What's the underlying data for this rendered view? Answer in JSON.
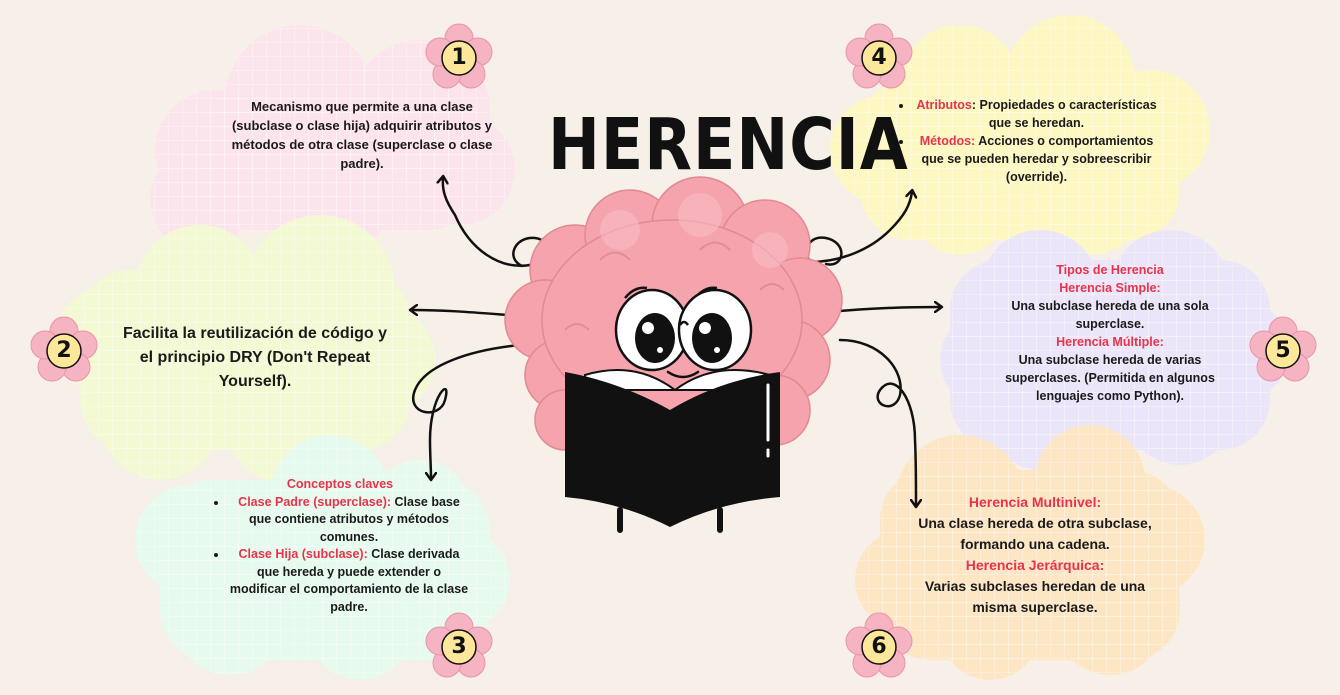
{
  "title": "HERENCIA",
  "colors": {
    "background": "#f7f0e8",
    "accent_red": "#e8334a",
    "cloud1": "#fce4ec",
    "cloud2": "#f3f9d2",
    "cloud3": "#e6fbee",
    "cloud4": "#fdf7c2",
    "cloud5": "#ebe5f9",
    "cloud6": "#fde6c4",
    "badge_petal": "#f6b3c2",
    "badge_center": "#fde79a"
  },
  "clouds": [
    {
      "number": "1",
      "text": "Mecanismo que permite a una clase (subclase o clase hija) adquirir atributos y métodos de otra clase (superclase o clase padre)."
    },
    {
      "number": "2",
      "text": "Facilita la reutilización de código y el principio DRY (Don't Repeat Yourself)."
    },
    {
      "number": "3",
      "heading": "Conceptos claves",
      "items": [
        {
          "label": "Clase Padre (superclase):",
          "text": " Clase base que contiene atributos y métodos comunes."
        },
        {
          "label": "Clase Hija (subclase):",
          "text": " Clase derivada que hereda y puede extender o modificar el comportamiento de la clase padre."
        }
      ]
    },
    {
      "number": "4",
      "items": [
        {
          "label": "Atributos",
          "text": ": Propiedades o características que se heredan."
        },
        {
          "label": "Métodos:",
          "text": " Acciones o comportamientos que se pueden heredar y sobreescribir (override)."
        }
      ]
    },
    {
      "number": "5",
      "heading": "Tipos de Herencia",
      "sub1_title": "Herencia Simple:",
      "sub1_text": "Una subclase hereda de una sola superclase.",
      "sub2_title": "Herencia Múltiple:",
      "sub2_text": "Una subclase hereda de varias superclases. (Permitida en algunos lenguajes como Python)."
    },
    {
      "number": "6",
      "sub1_title": "Herencia Multinivel:",
      "sub1_text": "Una clase hereda de otra subclase, formando una cadena.",
      "sub2_title": "Herencia Jerárquica:",
      "sub2_text": "Varias subclases heredan de una misma superclase."
    }
  ]
}
